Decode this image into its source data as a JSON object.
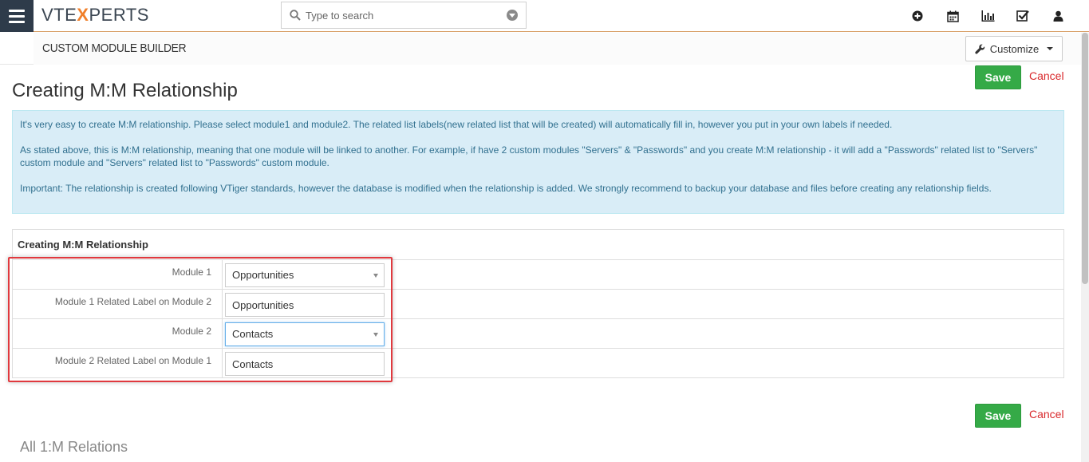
{
  "brand": {
    "part1": "VTE",
    "part2": "X",
    "part3": "PERTS"
  },
  "search": {
    "placeholder": "Type to search"
  },
  "top_icons": [
    "add-icon",
    "calendar-icon",
    "reports-icon",
    "tasks-icon",
    "user-icon"
  ],
  "subheader": {
    "module_title": "CUSTOM MODULE BUILDER",
    "customize_label": "Customize"
  },
  "page": {
    "title": "Creating M:M Relationship",
    "save_label": "Save",
    "cancel_label": "Cancel"
  },
  "info": {
    "p1": "It's very easy to create M:M relationship. Please select module1 and module2. The related list labels(new related list that will be created) will automatically fill in, however you put in your own labels if needed.",
    "p2": "As stated above, this is M:M relationship, meaning that one module will be linked to another. For example, if have 2 custom modules \"Servers\" & \"Passwords\" and you create M:M relationship - it will add a \"Passwords\" related list to \"Servers\" custom module and \"Servers\" related list to \"Passwords\" custom module.",
    "p3": "Important: The relationship is created following VTiger standards, however the database is modified when the relationship is added. We strongly recommend to backup your database and files before creating any relationship fields."
  },
  "form": {
    "heading": "Creating M:M Relationship",
    "rows": [
      {
        "label": "Module 1",
        "value": "Opportunities"
      },
      {
        "label": "Module 1 Related Label on Module 2",
        "value": "Opportunities"
      },
      {
        "label": "Module 2",
        "value": "Contacts"
      },
      {
        "label": "Module 2 Related Label on Module 1",
        "value": "Contacts"
      }
    ]
  },
  "footer_section": {
    "title": "All 1:M Relations"
  },
  "colors": {
    "save_green": "#35aa47",
    "cancel_red": "#d9292c",
    "info_bg": "#d9edf7",
    "info_text": "#31708f",
    "highlight_red": "#e0393e",
    "brand_orange": "#f07f2a"
  }
}
